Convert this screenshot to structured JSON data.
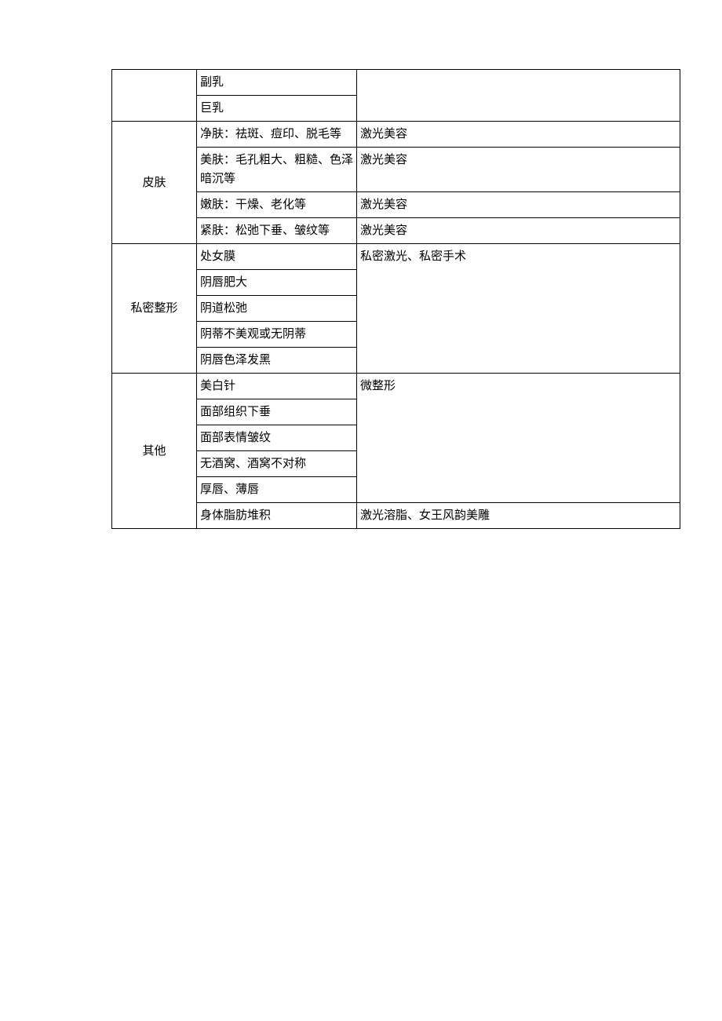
{
  "table": {
    "rows": [
      {
        "cat": "",
        "catRows": 2,
        "item": "副乳",
        "detail": "",
        "detailRows": 2
      },
      {
        "item": "巨乳"
      },
      {
        "cat": "皮肤",
        "catRows": 4,
        "item": "净肤：祛斑、痘印、脱毛等",
        "detail": "激光美容",
        "detailRows": 1
      },
      {
        "item": "美肤：毛孔粗大、粗糙、色泽暗沉等",
        "detail": "激光美容",
        "detailRows": 1
      },
      {
        "item": "嫩肤：干燥、老化等",
        "detail": "激光美容",
        "detailRows": 1
      },
      {
        "item": "紧肤：松弛下垂、皱纹等",
        "detail": "激光美容",
        "detailRows": 1
      },
      {
        "cat": "私密整形",
        "catRows": 5,
        "item": "处女膜",
        "detail": "私密激光、私密手术",
        "detailRows": 5
      },
      {
        "item": "阴唇肥大"
      },
      {
        "item": "阴道松弛"
      },
      {
        "item": "阴蒂不美观或无阴蒂"
      },
      {
        "item": "阴唇色泽发黑"
      },
      {
        "cat": "其他",
        "catRows": 6,
        "item": "美白针",
        "detail": "微整形",
        "detailRows": 5
      },
      {
        "item": "面部组织下垂"
      },
      {
        "item": "面部表情皱纹"
      },
      {
        "item": "无酒窝、酒窝不对称"
      },
      {
        "item": "厚唇、薄唇"
      },
      {
        "item": "身体脂肪堆积",
        "detail": "激光溶脂、女王风韵美雕",
        "detailRows": 1
      }
    ]
  }
}
